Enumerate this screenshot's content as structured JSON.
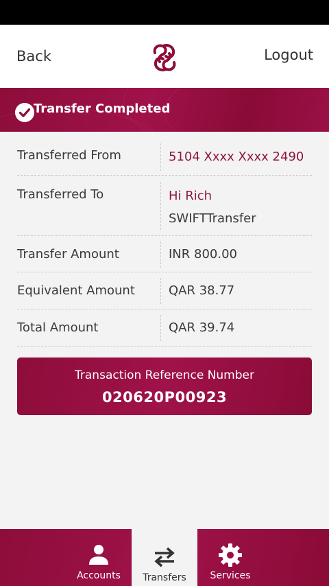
{
  "header": {
    "back_label": "Back",
    "logout_label": "Logout"
  },
  "banner": {
    "title": "Transfer Completed"
  },
  "details": {
    "from": {
      "label": "Transferred From",
      "value": "5104 Xxxx Xxxx 2490"
    },
    "to": {
      "label": "Transferred To",
      "value": "Hi Rich",
      "sub_value": "SWIFTTransfer"
    },
    "amount": {
      "label": "Transfer Amount",
      "value": "INR 800.00"
    },
    "equivalent": {
      "label": "Equivalent Amount",
      "value": "QAR 38.77"
    },
    "total": {
      "label": "Total Amount",
      "value": "QAR 39.74"
    }
  },
  "reference": {
    "label": "Transaction Reference Number",
    "number": "020620P00923"
  },
  "bottom_nav": {
    "items": [
      {
        "label": "Accounts",
        "icon": "person-icon",
        "active": false
      },
      {
        "label": "Transfers",
        "icon": "transfer-arrows-icon",
        "active": true
      },
      {
        "label": "Services",
        "icon": "gear-icon",
        "active": false
      }
    ]
  },
  "colors": {
    "brand": "#8d0d3a",
    "accent_text": "#8d1540",
    "background": "#f3f3f3"
  }
}
